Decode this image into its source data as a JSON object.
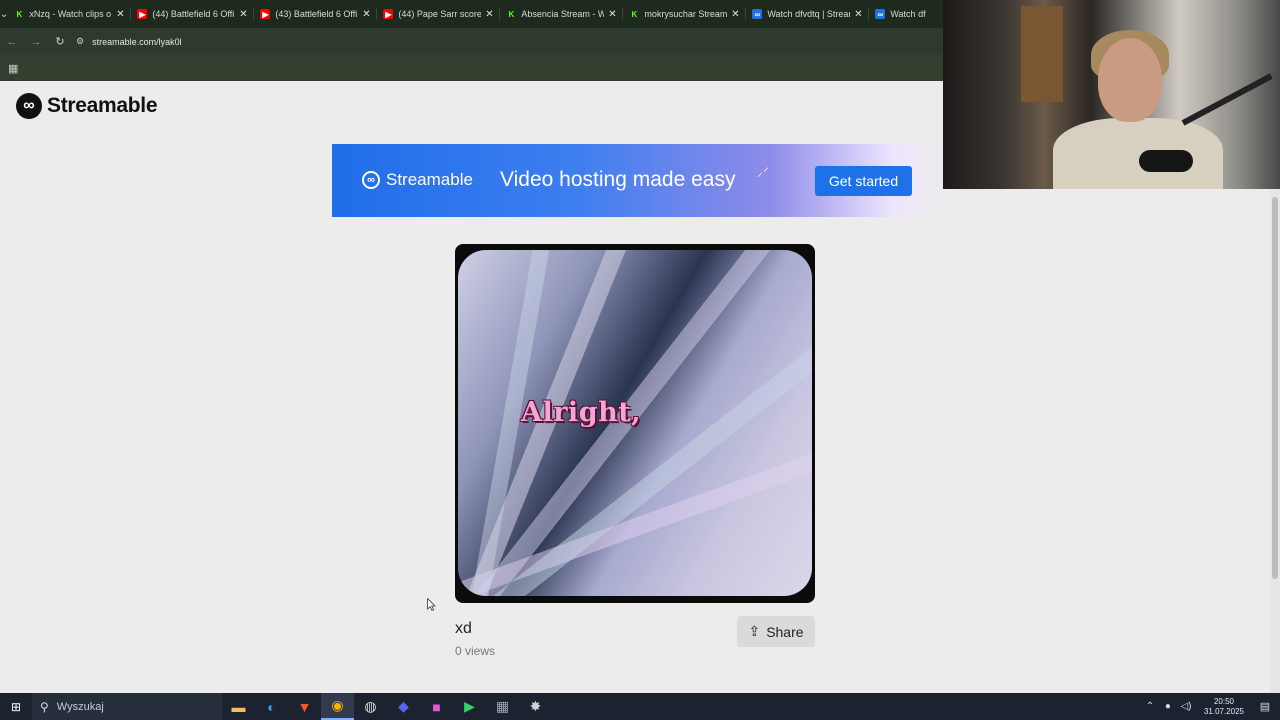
{
  "browser": {
    "tabs": [
      {
        "title": "xNzq - Watch clips o",
        "favicon": "K",
        "favicon_color": "#53fc18",
        "favicon_bg": "#1f2a1f"
      },
      {
        "title": "(44) Battlefield 6 Offi",
        "favicon": "▶",
        "favicon_color": "#ffffff",
        "favicon_bg": "#ff0000"
      },
      {
        "title": "(43) Battlefield 6 Offi",
        "favicon": "▶",
        "favicon_color": "#ffffff",
        "favicon_bg": "#ff0000"
      },
      {
        "title": "(44) Pape Sarr scores",
        "favicon": "▶",
        "favicon_color": "#ffffff",
        "favicon_bg": "#ff0000"
      },
      {
        "title": "Absencia Stream - W",
        "favicon": "K",
        "favicon_color": "#53fc18",
        "favicon_bg": "#1f2a1f"
      },
      {
        "title": "mokrysuchar Stream",
        "favicon": "K",
        "favicon_color": "#53fc18",
        "favicon_bg": "#1f2a1f"
      },
      {
        "title": "Watch dfvdtq | Stream",
        "favicon": "∞",
        "favicon_color": "#ffffff",
        "favicon_bg": "#1d72e8"
      },
      {
        "title": "Watch df",
        "favicon": "∞",
        "favicon_color": "#ffffff",
        "favicon_bg": "#1d72e8"
      }
    ],
    "url": "streamable.com/lyak0l"
  },
  "site": {
    "logo_text": "Streamable"
  },
  "banner": {
    "brand": "Streamable",
    "headline": "Video hosting made easy",
    "cta": "Get started"
  },
  "video": {
    "caption": "Alright,",
    "title": "xd",
    "views": "0 views",
    "share_label": "Share"
  },
  "taskbar": {
    "search_placeholder": "Wyszukaj",
    "apps": [
      {
        "name": "file-explorer-icon",
        "glyph": "▬",
        "color": "#f2c14e"
      },
      {
        "name": "edge-icon",
        "glyph": "◐",
        "color": "#2fa7e0"
      },
      {
        "name": "brave-icon",
        "glyph": "▼",
        "color": "#fb542b"
      },
      {
        "name": "chrome-icon",
        "glyph": "◉",
        "color": "#f4b400"
      },
      {
        "name": "obs-icon",
        "glyph": "◍",
        "color": "#d9d9d9"
      },
      {
        "name": "discord-icon",
        "glyph": "◆",
        "color": "#5865f2"
      },
      {
        "name": "game-launcher-icon",
        "glyph": "■",
        "color": "#e05ad6"
      },
      {
        "name": "play-icon",
        "glyph": "▶",
        "color": "#32d46a"
      },
      {
        "name": "calculator-icon",
        "glyph": "▦",
        "color": "#9aa6b8"
      },
      {
        "name": "app-icon",
        "glyph": "✸",
        "color": "#cfd3da"
      }
    ],
    "time": "20:50",
    "date": "31.07.2025"
  },
  "colors": {
    "accent": "#1d72e8",
    "page_bg": "#ececec"
  }
}
